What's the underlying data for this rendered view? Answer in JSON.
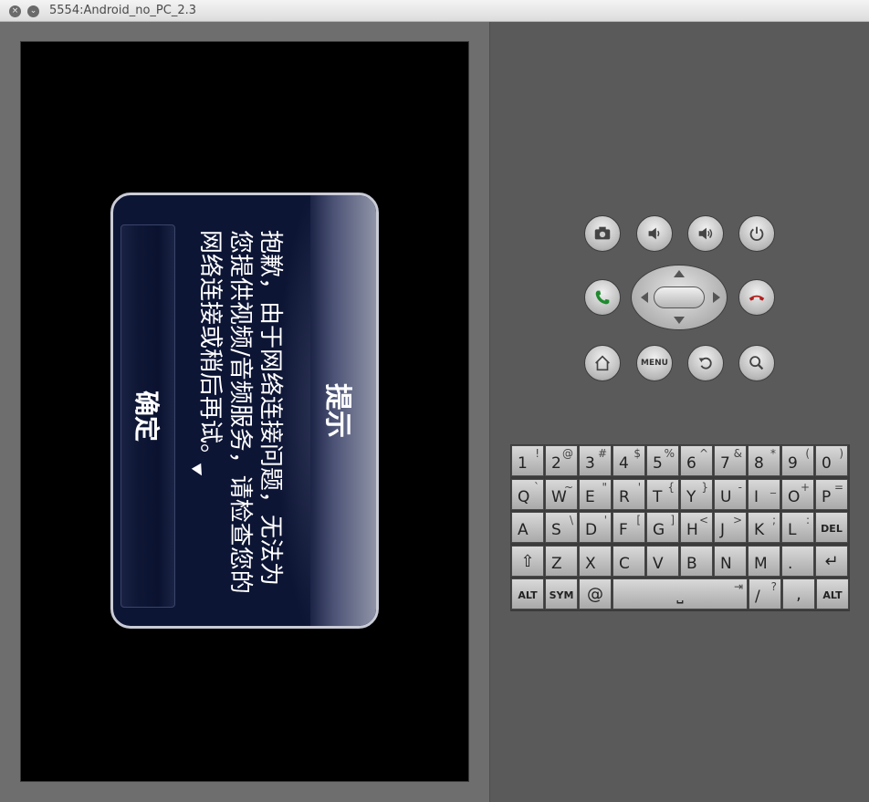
{
  "window": {
    "title": "5554:Android_no_PC_2.3",
    "close_glyph": "×",
    "min_glyph": "⌄"
  },
  "dialog": {
    "title": "提示",
    "message": "抱歉，由于网络连接问题，无法为您提供视频/音频服务，请检查您的网络连接或稍后再试。",
    "ok_label": "确定"
  },
  "hardware": {
    "menu_label": "MENU"
  },
  "keyboard": {
    "rows": [
      [
        [
          "1",
          "!"
        ],
        [
          "2",
          "@"
        ],
        [
          "3",
          "#"
        ],
        [
          "4",
          "$"
        ],
        [
          "5",
          "%"
        ],
        [
          "6",
          "^"
        ],
        [
          "7",
          "&"
        ],
        [
          "8",
          "*"
        ],
        [
          "9",
          "("
        ],
        [
          "0",
          ")"
        ]
      ],
      [
        [
          "Q",
          "`"
        ],
        [
          "W",
          "~"
        ],
        [
          "E",
          "\""
        ],
        [
          "R",
          "'"
        ],
        [
          "T",
          "{"
        ],
        [
          "Y",
          "}"
        ],
        [
          "U",
          "-"
        ],
        [
          "I",
          "_"
        ],
        [
          "O",
          "+"
        ],
        [
          "P",
          "="
        ]
      ],
      [
        [
          "A",
          ""
        ],
        [
          "S",
          "\\"
        ],
        [
          "D",
          "'"
        ],
        [
          "F",
          "["
        ],
        [
          "G",
          "]"
        ],
        [
          "H",
          "<"
        ],
        [
          "J",
          ">"
        ],
        [
          "K",
          ";"
        ],
        [
          "L",
          ":"
        ],
        [
          "DEL",
          ""
        ]
      ],
      [
        [
          "⇧",
          ""
        ],
        [
          "Z",
          ""
        ],
        [
          "X",
          ""
        ],
        [
          "C",
          ""
        ],
        [
          "V",
          ""
        ],
        [
          "B",
          ""
        ],
        [
          "N",
          ""
        ],
        [
          "M",
          ""
        ],
        [
          ".",
          ""
        ],
        [
          "↵",
          ""
        ]
      ]
    ],
    "bottom": {
      "alt_left": "ALT",
      "sym": "SYM",
      "at": "@",
      "space_glyph": "⎵",
      "tab_glyph": "⇥",
      "slash": "/",
      "question": "?",
      "comma": ",",
      "alt_right": "ALT"
    }
  }
}
